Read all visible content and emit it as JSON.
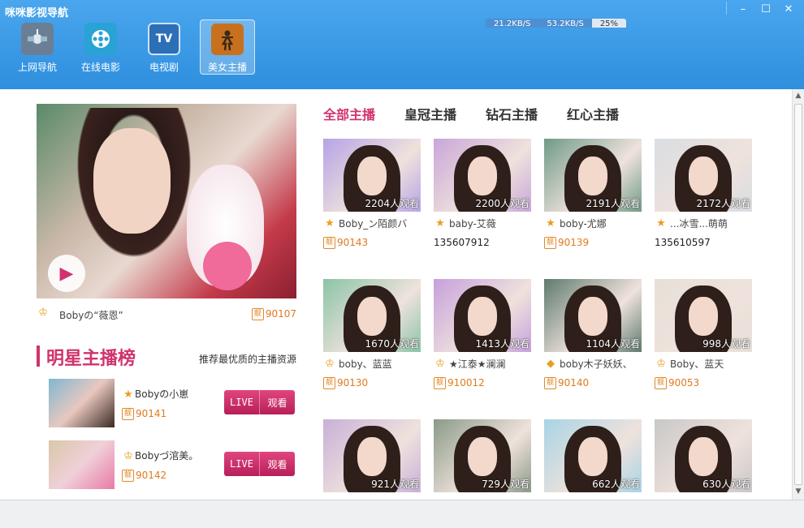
{
  "app": {
    "title": "咪咪影视导航"
  },
  "window_controls": {
    "minimize": "–",
    "maximize": "☐",
    "close": "✕"
  },
  "nav": {
    "items": [
      {
        "label": "上网导航",
        "icon": "satellite-icon",
        "color": "#6a7f95"
      },
      {
        "label": "在线电影",
        "icon": "film-reel-icon",
        "color": "#29a3d6"
      },
      {
        "label": "电视剧",
        "icon": "tv-icon",
        "icon_text": "TV",
        "color": "#2c6fb7"
      },
      {
        "label": "美女主播",
        "icon": "dancer-icon",
        "color": "#c8701e",
        "active": true
      }
    ]
  },
  "featured": {
    "name": "Bobyの“薇恩”",
    "id": "90107",
    "play_icon": "play-icon"
  },
  "star_section": {
    "title": "明星主播榜",
    "subtitle": "推荐最优质的主播资源",
    "live_label": "LIVE",
    "watch_label": "观看",
    "items": [
      {
        "name": "Bobyの小崽",
        "id": "90141",
        "badge": "star-crown-icon"
      },
      {
        "name": "Bobyづ涫美。",
        "id": "90142",
        "badge": "crown-icon"
      }
    ]
  },
  "tabs": [
    {
      "label": "全部主播",
      "active": true
    },
    {
      "label": "皇冠主播"
    },
    {
      "label": "钻石主播"
    },
    {
      "label": "红心主播"
    }
  ],
  "hosts": [
    {
      "name": "Boby_ン陌颜バ",
      "id": "90143",
      "viewers": "2204人观看",
      "badge": "star",
      "tone": "#b6a3e6"
    },
    {
      "name": "baby-艾薇",
      "id": "135607912",
      "viewers": "2200人观看",
      "badge": "star",
      "tone": "#c9a6d9",
      "plain_id": true
    },
    {
      "name": "boby-尤娜",
      "id": "90139",
      "viewers": "2191人观看",
      "badge": "star",
      "tone": "#6f9a86"
    },
    {
      "name": "...冰雪...萌萌",
      "id": "135610597",
      "viewers": "2172人观看",
      "badge": "star",
      "tone": "#d9dde2",
      "plain_id": true
    },
    {
      "name": "boby、蓝蓝",
      "id": "90130",
      "viewers": "1670人观看",
      "badge": "crown",
      "tone": "#8ac4a6"
    },
    {
      "name": "★江泰★澜澜",
      "id": "910012",
      "viewers": "1413人观看",
      "badge": "crown",
      "tone": "#c6a0dc"
    },
    {
      "name": "boby木子妖妖、",
      "id": "90140",
      "viewers": "1104人观看",
      "badge": "diamond",
      "tone": "#5e7a6e"
    },
    {
      "name": "Boby、蓝天",
      "id": "90053",
      "viewers": "998人观看",
      "badge": "crown",
      "tone": "#e7e0d8"
    },
    {
      "name": "",
      "id": "",
      "viewers": "921人观看",
      "badge": "",
      "tone": "#c8b0d8"
    },
    {
      "name": "",
      "id": "",
      "viewers": "729人观看",
      "badge": "",
      "tone": "#8a9a88"
    },
    {
      "name": "",
      "id": "",
      "viewers": "662人观看",
      "badge": "",
      "tone": "#a8d4e6"
    },
    {
      "name": "",
      "id": "",
      "viewers": "630人观看",
      "badge": "",
      "tone": "#c8c8c8"
    }
  ],
  "status": {
    "down": "21.2KB/S",
    "up": "53.2KB/S",
    "percent": "25%"
  }
}
